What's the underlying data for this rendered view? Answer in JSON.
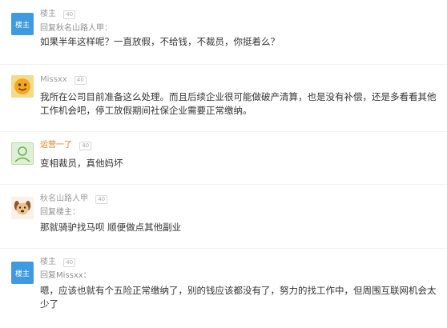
{
  "comments": [
    {
      "user": "楼主",
      "level": "40",
      "reply_to": "回复秋名山路人甲：",
      "text": "如果半年这样呢？一直放假，不给钱，不裁员，你挺着么？",
      "avatar_text": "楼主"
    },
    {
      "user": "Missxx",
      "level": "40",
      "text": "我所在公司目前准备这么处理。而且后续企业很可能做破产清算，也是没有补偿，还是多看看其他工作机会吧，停工放假期间社保企业需要正常缴纳。"
    },
    {
      "user": "运营一了",
      "level": "40",
      "text": "变相裁员，真他妈坏"
    },
    {
      "user": "秋名山路人甲",
      "level": "40",
      "reply_to": "回复楼主：",
      "text": "那就骑驴找马呗 顺便做点其他副业"
    },
    {
      "user": "楼主",
      "level": "40",
      "reply_to": "回复Missxx：",
      "text": "嗯，应该也就有个五险正常缴纳了，别的钱应该都没有了，努力的找工作中，但周围互联网机会太少了",
      "avatar_text": "楼主"
    }
  ],
  "colors": {
    "host_avatar": "#3f9ae0",
    "orange_name": "#e07c18",
    "text": "#333333",
    "meta": "#9a9a9a"
  }
}
